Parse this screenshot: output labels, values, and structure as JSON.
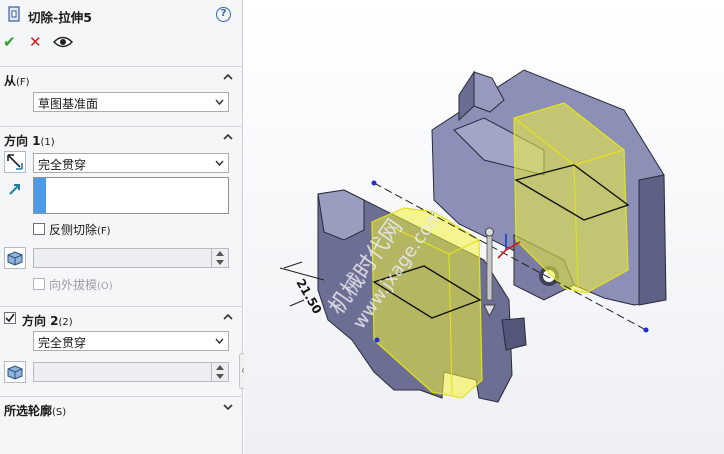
{
  "panel": {
    "title": "切除-拉伸5",
    "help": "?",
    "actions": {
      "ok": "✔",
      "cancel": "✕"
    },
    "from": {
      "label": "从",
      "hotkey": "(F)",
      "selected": "草图基准面"
    },
    "direction1": {
      "label": "方向 1",
      "hotkey": "(1)",
      "end_condition": "完全贯穿",
      "flip_side_label": "反侧切除",
      "flip_side_hotkey": "(F)",
      "draft_outward_label": "向外拔模",
      "draft_outward_hotkey": "(O)"
    },
    "direction2": {
      "label": "方向 2",
      "hotkey": "(2)",
      "checked": true,
      "end_condition": "完全贯穿"
    },
    "selected_contours": {
      "label": "所选轮廓",
      "hotkey": "(S)"
    }
  },
  "viewport": {
    "dimension_value": "21.50",
    "watermark_cn": "机械时代网",
    "watermark_url": "www.jxage.com",
    "highlight_color": "#f2f23a",
    "part_color": "#8f92b8"
  }
}
